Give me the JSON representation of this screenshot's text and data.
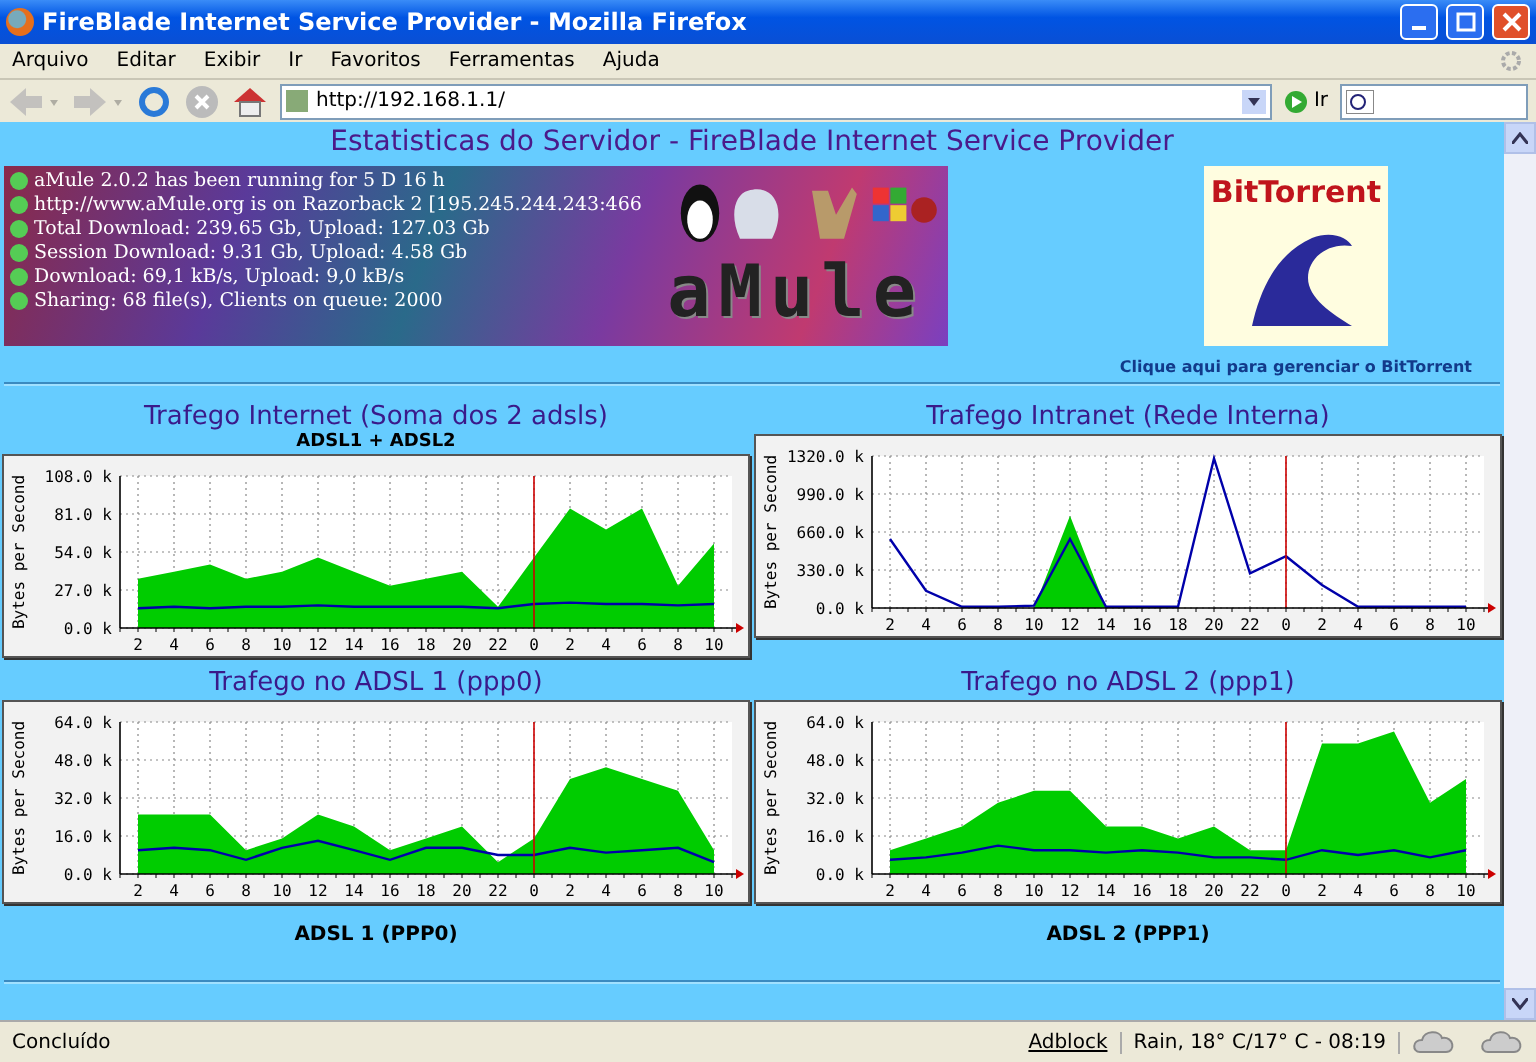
{
  "window": {
    "title": "FireBlade Internet Service Provider - Mozilla Firefox"
  },
  "menu": [
    "Arquivo",
    "Editar",
    "Exibir",
    "Ir",
    "Favoritos",
    "Ferramentas",
    "Ajuda"
  ],
  "toolbar": {
    "back_disabled": true,
    "forward_disabled": true,
    "url": "http://192.168.1.1/",
    "go_label": "Ir"
  },
  "page": {
    "heading": "Estatisticas do Servidor - FireBlade Internet Service Provider",
    "banner": {
      "lines": [
        "aMule 2.0.2 has been running for 5 D 16 h",
        "http://www.aMule.org is on Razorback 2 [195.245.244.243:466",
        "Total Download: 239.65 Gb, Upload: 127.03 Gb",
        "Session Download: 9.31 Gb, Upload: 4.58 Gb",
        "Download: 69,1 kB/s, Upload: 9,0 kB/s",
        "Sharing: 68 file(s), Clients on queue: 2000"
      ],
      "logo": "aMule"
    },
    "torrent": {
      "logo": "BitTorrent",
      "link": "Clique aqui para gerenciar o BitTorrent"
    },
    "charts": [
      {
        "title": "Trafego Internet (Soma dos 2 adsls)",
        "subtitle": "ADSL1 + ADSL2",
        "chart_data": {
          "type": "area",
          "grid": true,
          "ref_lines": [
            {
              "axis": "x",
              "value": "0",
              "color": "#cc0000"
            }
          ],
          "ylabel": "Bytes per Second",
          "ylim": [
            0,
            108
          ],
          "yticks": [
            {
              "value": 0,
              "label": "0.0 k"
            },
            {
              "value": 27,
              "label": "27.0 k"
            },
            {
              "value": 54,
              "label": "54.0 k"
            },
            {
              "value": 81,
              "label": "81.0 k"
            },
            {
              "value": 108,
              "label": "108.0 k"
            }
          ],
          "categories": [
            "2",
            "4",
            "6",
            "8",
            "10",
            "12",
            "14",
            "16",
            "18",
            "20",
            "22",
            "0",
            "2",
            "4",
            "6",
            "8",
            "10"
          ],
          "series": [
            {
              "type": "area",
              "color": "#00cc00",
              "values": [
                35,
                40,
                45,
                35,
                40,
                50,
                40,
                30,
                35,
                40,
                15,
                50,
                85,
                70,
                85,
                30,
                60
              ]
            },
            {
              "type": "line",
              "color": "#0000aa",
              "values": [
                14,
                15,
                14,
                15,
                15,
                16,
                15,
                15,
                15,
                15,
                14,
                17,
                18,
                17,
                17,
                16,
                17
              ]
            }
          ]
        }
      },
      {
        "title": "Trafego Intranet (Rede Interna)",
        "chart_data": {
          "type": "area",
          "grid": true,
          "ref_lines": [
            {
              "axis": "x",
              "value": "0",
              "color": "#cc0000"
            }
          ],
          "ylabel": "Bytes per Second",
          "ylim": [
            0,
            1320
          ],
          "yticks": [
            {
              "value": 0,
              "label": "0.0 k"
            },
            {
              "value": 330,
              "label": "330.0 k"
            },
            {
              "value": 660,
              "label": "660.0 k"
            },
            {
              "value": 990,
              "label": "990.0 k"
            },
            {
              "value": 1320,
              "label": "1320.0 k"
            }
          ],
          "categories": [
            "2",
            "4",
            "6",
            "8",
            "10",
            "12",
            "14",
            "16",
            "18",
            "20",
            "22",
            "0",
            "2",
            "4",
            "6",
            "8",
            "10"
          ],
          "series": [
            {
              "type": "area",
              "color": "#00cc00",
              "values": [
                0,
                0,
                0,
                0,
                0,
                800,
                0,
                0,
                0,
                0,
                0,
                0,
                0,
                0,
                0,
                0,
                0
              ]
            },
            {
              "type": "line",
              "color": "#0000aa",
              "values": [
                600,
                150,
                10,
                10,
                20,
                600,
                10,
                10,
                10,
                1300,
                300,
                450,
                200,
                10,
                10,
                10,
                10
              ]
            }
          ]
        }
      },
      {
        "title": "Trafego no ADSL 1 (ppp0)",
        "caption": "ADSL 1 (PPP0)",
        "chart_data": {
          "type": "area",
          "grid": true,
          "ref_lines": [
            {
              "axis": "x",
              "value": "0",
              "color": "#cc0000"
            }
          ],
          "ylabel": "Bytes per Second",
          "ylim": [
            0,
            64
          ],
          "yticks": [
            {
              "value": 0,
              "label": "0.0 k"
            },
            {
              "value": 16,
              "label": "16.0 k"
            },
            {
              "value": 32,
              "label": "32.0 k"
            },
            {
              "value": 48,
              "label": "48.0 k"
            },
            {
              "value": 64,
              "label": "64.0 k"
            }
          ],
          "categories": [
            "2",
            "4",
            "6",
            "8",
            "10",
            "12",
            "14",
            "16",
            "18",
            "20",
            "22",
            "0",
            "2",
            "4",
            "6",
            "8",
            "10"
          ],
          "series": [
            {
              "type": "area",
              "color": "#00cc00",
              "values": [
                25,
                25,
                25,
                10,
                15,
                25,
                20,
                10,
                15,
                20,
                5,
                15,
                40,
                45,
                40,
                35,
                10
              ]
            },
            {
              "type": "line",
              "color": "#0000aa",
              "values": [
                10,
                11,
                10,
                6,
                11,
                14,
                10,
                6,
                11,
                11,
                8,
                8,
                11,
                9,
                10,
                11,
                5
              ]
            }
          ]
        }
      },
      {
        "title": "Trafego no ADSL 2 (ppp1)",
        "caption": "ADSL 2 (PPP1)",
        "chart_data": {
          "type": "area",
          "grid": true,
          "ref_lines": [
            {
              "axis": "x",
              "value": "0",
              "color": "#cc0000"
            }
          ],
          "ylabel": "Bytes per Second",
          "ylim": [
            0,
            64
          ],
          "yticks": [
            {
              "value": 0,
              "label": "0.0 k"
            },
            {
              "value": 16,
              "label": "16.0 k"
            },
            {
              "value": 32,
              "label": "32.0 k"
            },
            {
              "value": 48,
              "label": "48.0 k"
            },
            {
              "value": 64,
              "label": "64.0 k"
            }
          ],
          "categories": [
            "2",
            "4",
            "6",
            "8",
            "10",
            "12",
            "14",
            "16",
            "18",
            "20",
            "22",
            "0",
            "2",
            "4",
            "6",
            "8",
            "10"
          ],
          "series": [
            {
              "type": "area",
              "color": "#00cc00",
              "values": [
                10,
                15,
                20,
                30,
                35,
                35,
                20,
                20,
                15,
                20,
                10,
                10,
                55,
                55,
                60,
                30,
                40
              ]
            },
            {
              "type": "line",
              "color": "#0000aa",
              "values": [
                6,
                7,
                9,
                12,
                10,
                10,
                9,
                10,
                9,
                7,
                7,
                6,
                10,
                8,
                10,
                7,
                10
              ]
            }
          ]
        }
      }
    ]
  },
  "status_bar": {
    "status": "Concluído",
    "adblock": "Adblock",
    "weather": "Rain, 18° C/17° C - 08:19"
  }
}
